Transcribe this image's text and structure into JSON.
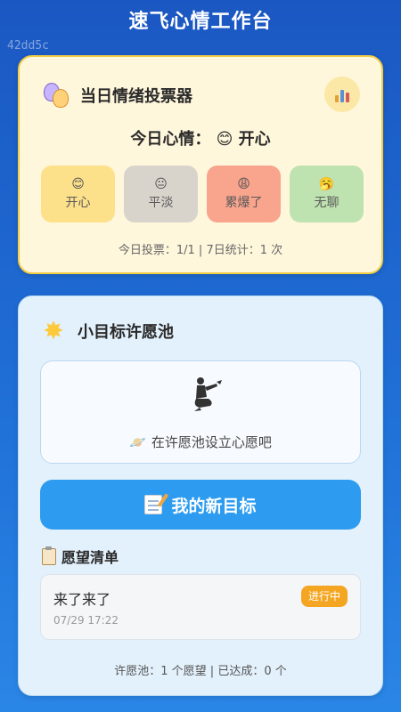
{
  "app": {
    "title": "速飞心情工作台",
    "watermark": "42dd5c"
  },
  "mood": {
    "header_icon": "theater-masks-icon",
    "title": "当日情绪投票器",
    "stats_button_icon": "bar-chart-icon",
    "today_label": "今日心情：",
    "today_emoji": "😊",
    "today_value": "开心",
    "options": [
      {
        "emoji": "😊",
        "label": "开心",
        "color": "#fde08a"
      },
      {
        "emoji": "😐",
        "label": "平淡",
        "color": "#d9d4cb"
      },
      {
        "emoji": "😩",
        "label": "累爆了",
        "color": "#f9a48c"
      },
      {
        "emoji": "🥱",
        "label": "无聊",
        "color": "#bfe3b0"
      }
    ],
    "vote_stats": "今日投票：1/1 | 7日统计：1 次"
  },
  "wish": {
    "header_icon": "sparkle-star-icon",
    "title": "小目标许愿池",
    "pool_icon": "genie-icon",
    "pool_text": "在许愿池设立心愿吧",
    "pool_text_icon": "ringed-planet-icon",
    "new_goal_label": "我的新目标",
    "new_goal_icon": "memo-icon",
    "list_title": "愿望清单",
    "list_icon": "clipboard-icon",
    "items": [
      {
        "title": "来了来了",
        "time": "07/29 17:22",
        "status": "进行中"
      }
    ],
    "stats": "许愿池：1 个愿望 | 已达成：0 个"
  },
  "colors": {
    "background": "#1f6fd6",
    "mood_card": "#fff7dc",
    "mood_card_border": "#f2cc45",
    "wish_card": "#e3f1fc",
    "primary_button": "#2d9cf0",
    "status_badge": "#f4a623"
  }
}
